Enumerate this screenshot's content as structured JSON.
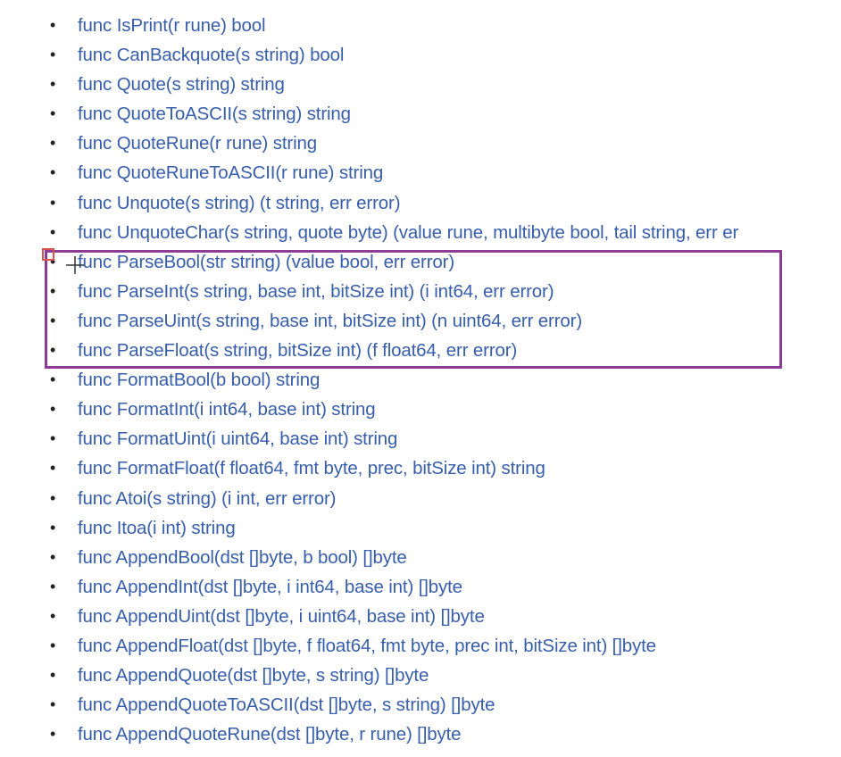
{
  "functions": [
    "func IsPrint(r rune) bool",
    "func CanBackquote(s string) bool",
    "func Quote(s string) string",
    "func QuoteToASCII(s string) string",
    "func QuoteRune(r rune) string",
    "func QuoteRuneToASCII(r rune) string",
    "func Unquote(s string) (t string, err error)",
    "func UnquoteChar(s string, quote byte) (value rune, multibyte bool, tail string, err er",
    "func ParseBool(str string) (value bool, err error)",
    "func ParseInt(s string, base int, bitSize int) (i int64, err error)",
    "func ParseUint(s string, base int, bitSize int) (n uint64, err error)",
    "func ParseFloat(s string, bitSize int) (f float64, err error)",
    "func FormatBool(b bool) string",
    "func FormatInt(i int64, base int) string",
    "func FormatUint(i uint64, base int) string",
    "func FormatFloat(f float64, fmt byte, prec, bitSize int) string",
    "func Atoi(s string) (i int, err error)",
    "func Itoa(i int) string",
    "func AppendBool(dst []byte, b bool) []byte",
    "func AppendInt(dst []byte, i int64, base int) []byte",
    "func AppendUint(dst []byte, i uint64, base int) []byte",
    "func AppendFloat(dst []byte, f float64, fmt byte, prec int, bitSize int) []byte",
    "func AppendQuote(dst []byte, s string) []byte",
    "func AppendQuoteToASCII(dst []byte, s string) []byte",
    "func AppendQuoteRune(dst []byte, r rune) []byte"
  ],
  "bullet": "•",
  "colors": {
    "link": "#375eab",
    "highlight_border": "#8e3b96",
    "marker": "#d9534f"
  },
  "icons": {
    "crosshair": "crosshair-cursor-icon",
    "marker": "selection-corner-marker"
  }
}
